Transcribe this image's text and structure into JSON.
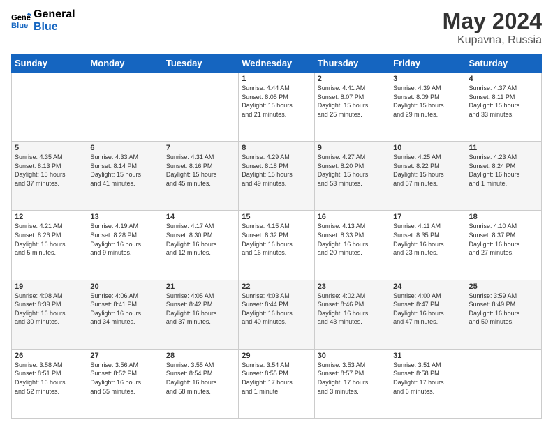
{
  "header": {
    "logo_line1": "General",
    "logo_line2": "Blue",
    "title": "May 2024",
    "subtitle": "Kupavna, Russia"
  },
  "weekdays": [
    "Sunday",
    "Monday",
    "Tuesday",
    "Wednesday",
    "Thursday",
    "Friday",
    "Saturday"
  ],
  "weeks": [
    [
      {
        "day": "",
        "info": ""
      },
      {
        "day": "",
        "info": ""
      },
      {
        "day": "",
        "info": ""
      },
      {
        "day": "1",
        "info": "Sunrise: 4:44 AM\nSunset: 8:05 PM\nDaylight: 15 hours\nand 21 minutes."
      },
      {
        "day": "2",
        "info": "Sunrise: 4:41 AM\nSunset: 8:07 PM\nDaylight: 15 hours\nand 25 minutes."
      },
      {
        "day": "3",
        "info": "Sunrise: 4:39 AM\nSunset: 8:09 PM\nDaylight: 15 hours\nand 29 minutes."
      },
      {
        "day": "4",
        "info": "Sunrise: 4:37 AM\nSunset: 8:11 PM\nDaylight: 15 hours\nand 33 minutes."
      }
    ],
    [
      {
        "day": "5",
        "info": "Sunrise: 4:35 AM\nSunset: 8:13 PM\nDaylight: 15 hours\nand 37 minutes."
      },
      {
        "day": "6",
        "info": "Sunrise: 4:33 AM\nSunset: 8:14 PM\nDaylight: 15 hours\nand 41 minutes."
      },
      {
        "day": "7",
        "info": "Sunrise: 4:31 AM\nSunset: 8:16 PM\nDaylight: 15 hours\nand 45 minutes."
      },
      {
        "day": "8",
        "info": "Sunrise: 4:29 AM\nSunset: 8:18 PM\nDaylight: 15 hours\nand 49 minutes."
      },
      {
        "day": "9",
        "info": "Sunrise: 4:27 AM\nSunset: 8:20 PM\nDaylight: 15 hours\nand 53 minutes."
      },
      {
        "day": "10",
        "info": "Sunrise: 4:25 AM\nSunset: 8:22 PM\nDaylight: 15 hours\nand 57 minutes."
      },
      {
        "day": "11",
        "info": "Sunrise: 4:23 AM\nSunset: 8:24 PM\nDaylight: 16 hours\nand 1 minute."
      }
    ],
    [
      {
        "day": "12",
        "info": "Sunrise: 4:21 AM\nSunset: 8:26 PM\nDaylight: 16 hours\nand 5 minutes."
      },
      {
        "day": "13",
        "info": "Sunrise: 4:19 AM\nSunset: 8:28 PM\nDaylight: 16 hours\nand 9 minutes."
      },
      {
        "day": "14",
        "info": "Sunrise: 4:17 AM\nSunset: 8:30 PM\nDaylight: 16 hours\nand 12 minutes."
      },
      {
        "day": "15",
        "info": "Sunrise: 4:15 AM\nSunset: 8:32 PM\nDaylight: 16 hours\nand 16 minutes."
      },
      {
        "day": "16",
        "info": "Sunrise: 4:13 AM\nSunset: 8:33 PM\nDaylight: 16 hours\nand 20 minutes."
      },
      {
        "day": "17",
        "info": "Sunrise: 4:11 AM\nSunset: 8:35 PM\nDaylight: 16 hours\nand 23 minutes."
      },
      {
        "day": "18",
        "info": "Sunrise: 4:10 AM\nSunset: 8:37 PM\nDaylight: 16 hours\nand 27 minutes."
      }
    ],
    [
      {
        "day": "19",
        "info": "Sunrise: 4:08 AM\nSunset: 8:39 PM\nDaylight: 16 hours\nand 30 minutes."
      },
      {
        "day": "20",
        "info": "Sunrise: 4:06 AM\nSunset: 8:41 PM\nDaylight: 16 hours\nand 34 minutes."
      },
      {
        "day": "21",
        "info": "Sunrise: 4:05 AM\nSunset: 8:42 PM\nDaylight: 16 hours\nand 37 minutes."
      },
      {
        "day": "22",
        "info": "Sunrise: 4:03 AM\nSunset: 8:44 PM\nDaylight: 16 hours\nand 40 minutes."
      },
      {
        "day": "23",
        "info": "Sunrise: 4:02 AM\nSunset: 8:46 PM\nDaylight: 16 hours\nand 43 minutes."
      },
      {
        "day": "24",
        "info": "Sunrise: 4:00 AM\nSunset: 8:47 PM\nDaylight: 16 hours\nand 47 minutes."
      },
      {
        "day": "25",
        "info": "Sunrise: 3:59 AM\nSunset: 8:49 PM\nDaylight: 16 hours\nand 50 minutes."
      }
    ],
    [
      {
        "day": "26",
        "info": "Sunrise: 3:58 AM\nSunset: 8:51 PM\nDaylight: 16 hours\nand 52 minutes."
      },
      {
        "day": "27",
        "info": "Sunrise: 3:56 AM\nSunset: 8:52 PM\nDaylight: 16 hours\nand 55 minutes."
      },
      {
        "day": "28",
        "info": "Sunrise: 3:55 AM\nSunset: 8:54 PM\nDaylight: 16 hours\nand 58 minutes."
      },
      {
        "day": "29",
        "info": "Sunrise: 3:54 AM\nSunset: 8:55 PM\nDaylight: 17 hours\nand 1 minute."
      },
      {
        "day": "30",
        "info": "Sunrise: 3:53 AM\nSunset: 8:57 PM\nDaylight: 17 hours\nand 3 minutes."
      },
      {
        "day": "31",
        "info": "Sunrise: 3:51 AM\nSunset: 8:58 PM\nDaylight: 17 hours\nand 6 minutes."
      },
      {
        "day": "",
        "info": ""
      }
    ]
  ]
}
